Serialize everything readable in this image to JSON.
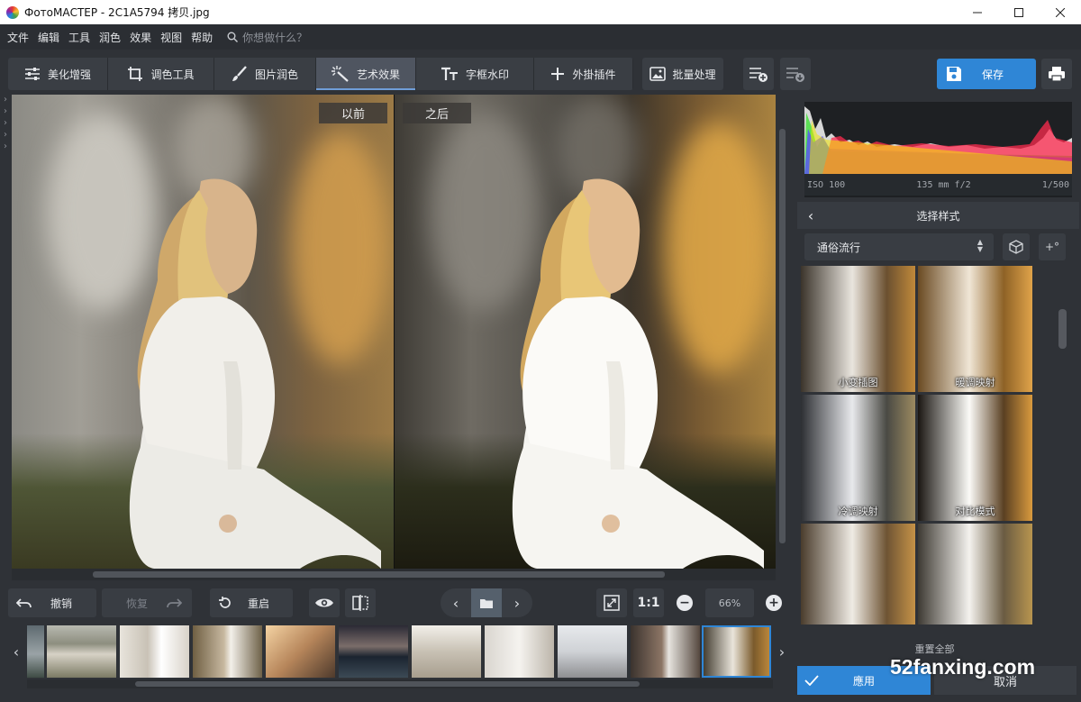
{
  "window": {
    "title": "ФотоМАСТЕР - 2C1A5794 拷贝.jpg",
    "minimize_icon": "minimize-icon",
    "maximize_icon": "maximize-icon",
    "close_icon": "close-icon"
  },
  "menu": {
    "items": [
      "文件",
      "编辑",
      "工具",
      "润色",
      "效果",
      "视图",
      "帮助"
    ],
    "search_placeholder": "你想做什么？"
  },
  "toolbar": {
    "tabs": [
      {
        "label": "美化增强",
        "icon": "sliders-icon"
      },
      {
        "label": "调色工具",
        "icon": "crop-icon"
      },
      {
        "label": "图片润色",
        "icon": "brush-icon"
      },
      {
        "label": "艺术效果",
        "icon": "magic-wand-icon",
        "active": true
      },
      {
        "label": "字框水印",
        "icon": "text-icon"
      },
      {
        "label": "外掛插件",
        "icon": "plus-icon"
      }
    ],
    "batch_label": "批量处理",
    "save_label": "保存",
    "accent_color": "#2f86d6"
  },
  "canvas": {
    "before_label": "以前",
    "after_label": "之后"
  },
  "actions": {
    "undo_label": "撤销",
    "redo_label": "恢复",
    "reset_label": "重启",
    "actual_size_label": "1:1",
    "zoom_value": "66%"
  },
  "filmstrip": {
    "count": 10,
    "selected_index": 9
  },
  "right_panel": {
    "exif": {
      "iso": "ISO 100",
      "lens": "135 mm f/2",
      "shutter": "1/500"
    },
    "style_title": "选择样式",
    "style_category": "通俗流行",
    "add_label": "+°",
    "presets": [
      "小变插图",
      "暖调映射",
      "冷调映射",
      "对比模式",
      "",
      ""
    ],
    "reset_all_label": "重置全部",
    "apply_label": "應用",
    "cancel_label": "取消"
  },
  "watermark": "52fanxing.com"
}
